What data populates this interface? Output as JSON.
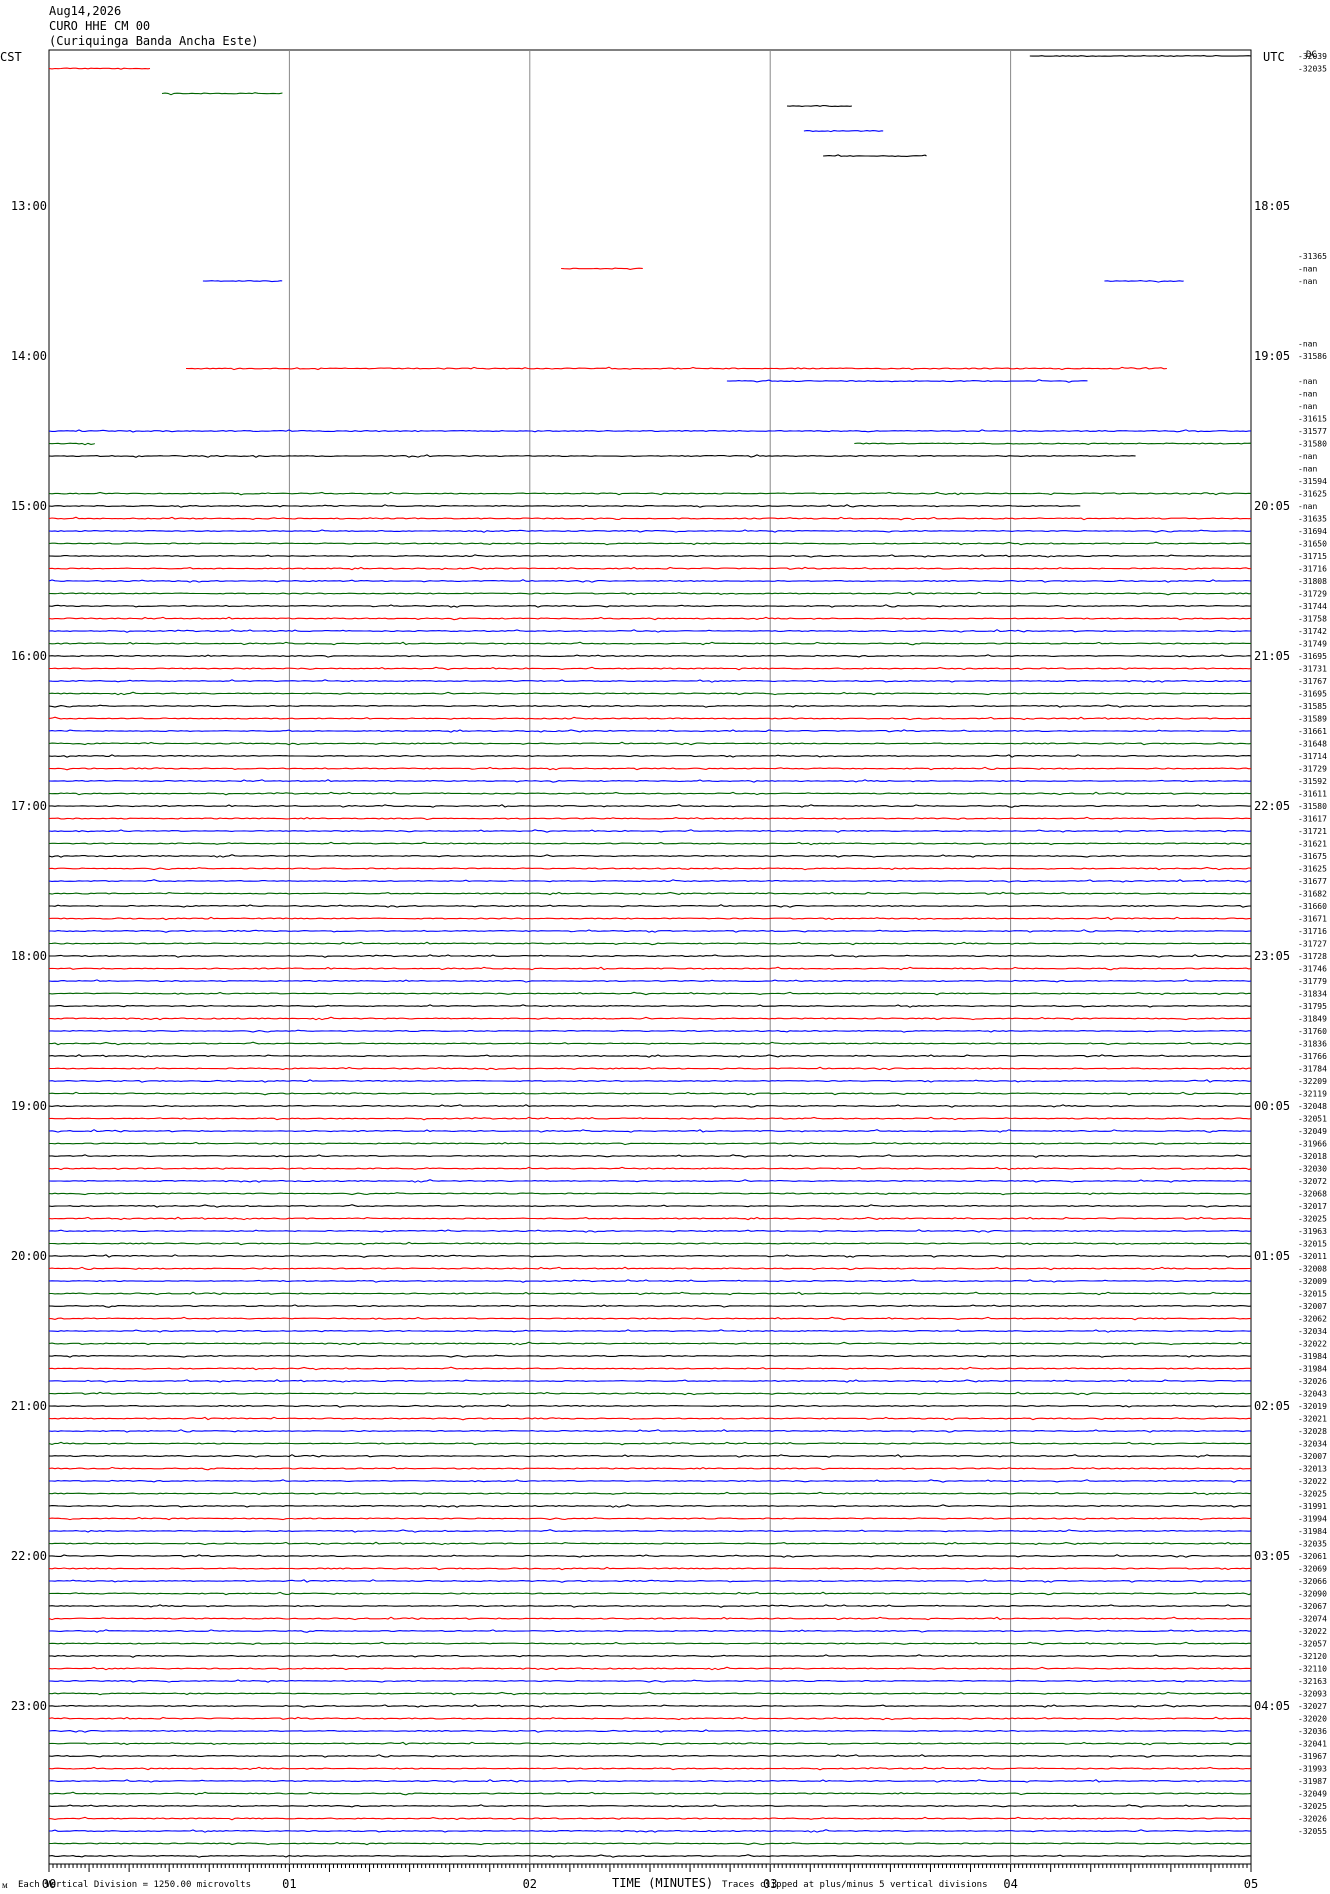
{
  "header": {
    "date": "Aug14,2026",
    "station": "CURO HHE CM 00",
    "description": "(Curiquinga Banda Ancha Este)"
  },
  "corners": {
    "left_tz": "CST",
    "right_tz": "UTC",
    "dc": "DC"
  },
  "footer": {
    "mark": "ᴍ",
    "division_note": "Each Vertical Division = 1250.00 microvolts",
    "xlabel": "TIME (MINUTES)",
    "clip_note": "Traces clipped at plus/minus 5 vertical divisions"
  },
  "chart_data": {
    "type": "line",
    "title": "",
    "xlabel": "TIME (MINUTES)",
    "ylabel": "",
    "xlim": [
      0,
      5
    ],
    "x_ticks": [
      "00",
      "01",
      "02",
      "03",
      "04",
      "05"
    ],
    "grid": true,
    "colors": [
      "#000000",
      "#ff0000",
      "#0000ff",
      "#006400"
    ],
    "left_hour_labels": [
      {
        "row": 12,
        "text": "13:00"
      },
      {
        "row": 24,
        "text": "14:00"
      },
      {
        "row": 36,
        "text": "15:00"
      },
      {
        "row": 48,
        "text": "16:00"
      },
      {
        "row": 60,
        "text": "17:00"
      },
      {
        "row": 72,
        "text": "18:00"
      },
      {
        "row": 84,
        "text": "19:00"
      },
      {
        "row": 96,
        "text": "20:00"
      },
      {
        "row": 108,
        "text": "21:00"
      },
      {
        "row": 120,
        "text": "22:00"
      },
      {
        "row": 132,
        "text": "23:00"
      }
    ],
    "right_hour_labels": [
      {
        "row": 12,
        "text": "18:05"
      },
      {
        "row": 24,
        "text": "19:05"
      },
      {
        "row": 36,
        "text": "20:05"
      },
      {
        "row": 48,
        "text": "21:05"
      },
      {
        "row": 60,
        "text": "22:05"
      },
      {
        "row": 72,
        "text": "23:05"
      },
      {
        "row": 84,
        "text": "00:05"
      },
      {
        "row": 96,
        "text": "01:05"
      },
      {
        "row": 108,
        "text": "02:05"
      },
      {
        "row": 120,
        "text": "03:05"
      },
      {
        "row": 132,
        "text": "04:05"
      }
    ],
    "dc_offsets": [
      "-32039",
      "-32035",
      "",
      "",
      "",
      "",
      "",
      "",
      "",
      "",
      "",
      "",
      "",
      "",
      "",
      "",
      "-31365",
      "-nan",
      "-nan",
      "",
      "",
      "",
      "",
      "-nan",
      "-31586",
      "",
      "-nan",
      "-nan",
      "-nan",
      "-31615",
      "-31577",
      "-31580",
      "-nan",
      "-nan",
      "-31594",
      "-31625",
      "-nan",
      "-31635",
      "-31694",
      "-31650",
      "-31715",
      "-31716",
      "-31808",
      "-31729",
      "-31744",
      "-31758",
      "-31742",
      "-31749",
      "-31695",
      "-31731",
      "-31767",
      "-31695",
      "-31585",
      "-31589",
      "-31661",
      "-31648",
      "-31714",
      "-31729",
      "-31592",
      "-31611",
      "-31580",
      "-31617",
      "-31721",
      "-31621",
      "-31675",
      "-31625",
      "-31677",
      "-31682",
      "-31660",
      "-31671",
      "-31716",
      "-31727",
      "-31728",
      "-31746",
      "-31779",
      "-31834",
      "-31795",
      "-31849",
      "-31760",
      "-31836",
      "-31766",
      "-31784",
      "-32209",
      "-32119",
      "-32048",
      "-32051",
      "-32049",
      "-31966",
      "-32018",
      "-32030",
      "-32072",
      "-32068",
      "-32017",
      "-32025",
      "-31963",
      "-32015",
      "-32011",
      "-32008",
      "-32009",
      "-32015",
      "-32007",
      "-32062",
      "-32034",
      "-32022",
      "-31984",
      "-31984",
      "-32026",
      "-32043",
      "-32019",
      "-32021",
      "-32028",
      "-32034",
      "-32007",
      "-32013",
      "-32022",
      "-32025",
      "-31991",
      "-31994",
      "-31984",
      "-32035",
      "-32061",
      "-32069",
      "-32066",
      "-32090",
      "-32067",
      "-32074",
      "-32022",
      "-32057",
      "-32120",
      "-32110",
      "-32163",
      "-32093",
      "-32027",
      "-32020",
      "-32036",
      "-32041",
      "-31967",
      "-31993",
      "-31987",
      "-32049",
      "-32025",
      "-32026",
      "-32055"
    ],
    "series": [
      {
        "row": 0,
        "color": "#000000",
        "x_ranges": [
          [
            4.08,
            5.0
          ]
        ]
      },
      {
        "row": 1,
        "color": "#ff0000",
        "x_ranges": [
          [
            0.0,
            0.42
          ]
        ]
      },
      {
        "row": 3,
        "color": "#006400",
        "x_ranges": [
          [
            0.47,
            0.97
          ]
        ]
      },
      {
        "row": 4,
        "color": "#000000",
        "x_ranges": [
          [
            3.07,
            3.34
          ]
        ]
      },
      {
        "row": 6,
        "color": "#0000ff",
        "x_ranges": [
          [
            3.14,
            3.47
          ]
        ]
      },
      {
        "row": 8,
        "color": "#000000",
        "x_ranges": [
          [
            3.22,
            3.65
          ]
        ]
      },
      {
        "row": 17,
        "color": "#ff0000",
        "x_ranges": [
          [
            2.13,
            2.47
          ]
        ]
      },
      {
        "row": 18,
        "color": "#0000ff",
        "x_ranges": [
          [
            0.64,
            0.97
          ],
          [
            4.39,
            4.72
          ]
        ]
      },
      {
        "row": 25,
        "color": "#ff0000",
        "x_ranges": [
          [
            0.57,
            4.65
          ]
        ]
      },
      {
        "row": 26,
        "color": "#0000ff",
        "x_ranges": [
          [
            2.82,
            4.32
          ]
        ]
      },
      {
        "row": 30,
        "color": "#0000ff",
        "x_ranges": [
          [
            0.0,
            5.0
          ]
        ]
      },
      {
        "row": 31,
        "color": "#006400",
        "x_ranges": [
          [
            0.0,
            0.19
          ],
          [
            3.35,
            5.0
          ]
        ]
      },
      {
        "row": 32,
        "color": "#000000",
        "x_ranges": [
          [
            0.0,
            4.52
          ]
        ]
      },
      {
        "row": 35,
        "color": "#006400",
        "x_ranges": [
          [
            0.0,
            5.0
          ]
        ]
      },
      {
        "row": 36,
        "color": "#000000",
        "x_ranges": [
          [
            0.0,
            4.29
          ]
        ]
      },
      {
        "row": 37,
        "color": "#ff0000",
        "x_ranges": [
          [
            0.0,
            5.0
          ]
        ]
      },
      {
        "row": 38,
        "color": "#0000ff",
        "x_ranges": [
          [
            0.0,
            5.0
          ]
        ]
      }
    ],
    "continuous_from_row": 39,
    "continuous_to_row": 144,
    "color_cycle": [
      "#006400",
      "#000000",
      "#ff0000",
      "#0000ff"
    ]
  }
}
